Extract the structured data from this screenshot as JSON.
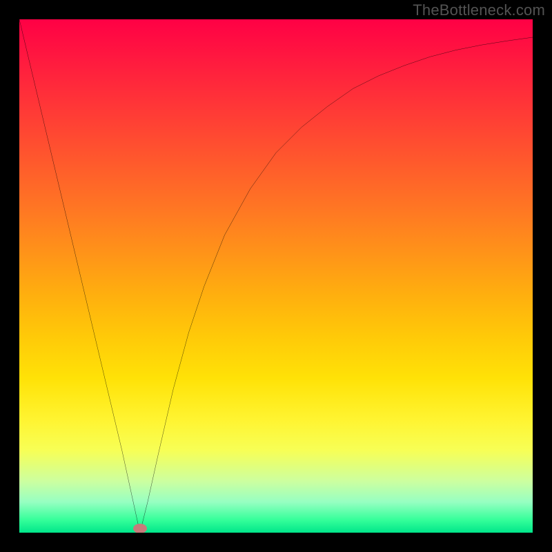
{
  "watermark": "TheBottleneck.com",
  "marker": {
    "x_pct": 23.5,
    "y_pct": 99.2
  },
  "chart_data": {
    "type": "line",
    "title": "",
    "xlabel": "",
    "ylabel": "",
    "xlim": [
      0,
      100
    ],
    "ylim": [
      0,
      100
    ],
    "series": [
      {
        "name": "bottleneck-curve",
        "x": [
          0,
          5,
          10,
          15,
          20,
          23.5,
          25,
          27,
          30,
          33,
          36,
          40,
          45,
          50,
          55,
          60,
          65,
          70,
          75,
          80,
          85,
          90,
          95,
          100
        ],
        "y": [
          100,
          79,
          58,
          37,
          16,
          0,
          6,
          15,
          28,
          39,
          48,
          58,
          67,
          74,
          79,
          83,
          86.5,
          89,
          91,
          92.7,
          94,
          95,
          95.8,
          96.5
        ]
      }
    ],
    "background_gradient_stops": [
      {
        "pct": 0,
        "color": "#ff0045"
      },
      {
        "pct": 50,
        "color": "#ffb00e"
      },
      {
        "pct": 80,
        "color": "#fff431"
      },
      {
        "pct": 100,
        "color": "#00e68a"
      }
    ],
    "marker_point": {
      "x": 23.5,
      "y": 0
    }
  }
}
